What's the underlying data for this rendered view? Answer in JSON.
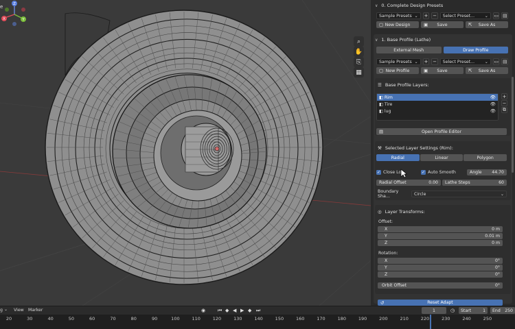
{
  "viewport": {
    "corner_text": "e",
    "gizmo": {
      "z": "Z",
      "x": "X",
      "y": "Y"
    },
    "tool_icons": [
      "zoom-icon",
      "hand-icon",
      "camera-icon",
      "grid-icon"
    ]
  },
  "panel": {
    "complete_presets": {
      "title": "0. Complete Design Presets",
      "preset_dropdown": "Sample Presets",
      "select_dropdown": "Select Preset...",
      "new_label": "New Design",
      "save_label": "Save",
      "save_as_label": "Save As"
    },
    "base_profile": {
      "title": "1. Base Profile (Lathe)",
      "tabs": [
        "External Mesh",
        "Draw Profile"
      ],
      "active_tab": "Draw Profile",
      "preset_dropdown": "Sample Presets",
      "select_dropdown": "Select Preset...",
      "new_label": "New Profile",
      "save_label": "Save",
      "save_as_label": "Save As"
    },
    "layers": {
      "title": "Base Profile Layers:",
      "items": [
        {
          "label": "Rim",
          "selected": true
        },
        {
          "label": "Tire",
          "selected": false
        },
        {
          "label": "lug",
          "selected": false
        }
      ],
      "open_editor_label": "Open Profile Editor"
    },
    "layer_settings": {
      "title": "Selected Layer Settings (Rim):",
      "modes": [
        "Radial",
        "Linear",
        "Polygon"
      ],
      "active_mode": "Radial",
      "close_loop_label": "Close Lo",
      "auto_smooth_label": "Auto Smooth",
      "angle_label": "Angle",
      "angle_value": "44.70",
      "radial_offset_label": "Radial Offset",
      "radial_offset_value": "0.00",
      "lathe_steps_label": "Lathe Steps",
      "lathe_steps_value": "60",
      "boundary_label": "Boundary Sha...",
      "boundary_value": "Circle"
    },
    "transforms": {
      "title": "Layer Transforms:",
      "offset_label": "Offset:",
      "offset": [
        {
          "axis": "X",
          "value": "0 m"
        },
        {
          "axis": "Y",
          "value": "0.01 m"
        },
        {
          "axis": "Z",
          "value": "0 m"
        }
      ],
      "rotation_label": "Rotation:",
      "rotation": [
        {
          "axis": "X",
          "value": "0°"
        },
        {
          "axis": "Y",
          "value": "0°"
        },
        {
          "axis": "Z",
          "value": "0°"
        }
      ],
      "orbit_label": "Orbit Offset",
      "orbit_value": "0°",
      "reset_label": "Reset Adapt"
    }
  },
  "timeline": {
    "menu": [
      "g",
      "View",
      "Marker"
    ],
    "current_frame": "1",
    "start_label": "Start",
    "start_value": "1",
    "end_label": "End",
    "end_value": "250",
    "ticks": [
      "20",
      "30",
      "40",
      "50",
      "60",
      "70",
      "80",
      "90",
      "100",
      "110",
      "120",
      "130",
      "140",
      "150",
      "160",
      "170",
      "180",
      "190",
      "200",
      "210",
      "220",
      "230",
      "240",
      "250"
    ]
  },
  "colors": {
    "accent": "#4772b3",
    "panel": "#2a2a2a",
    "viewport": "#3a3a3a"
  }
}
